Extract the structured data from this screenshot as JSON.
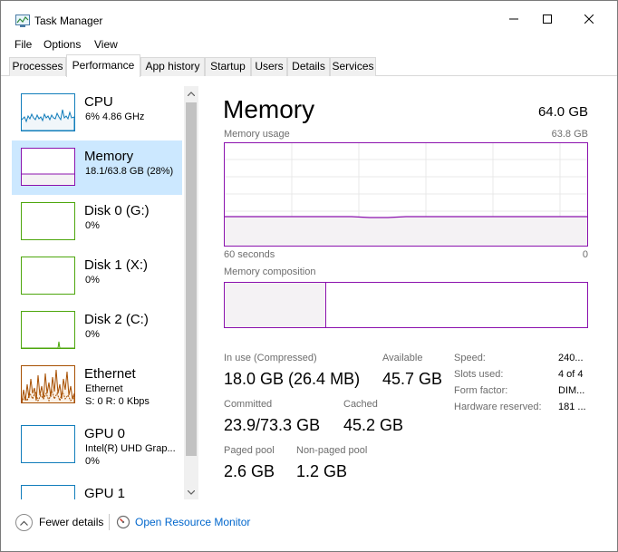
{
  "window": {
    "title": "Task Manager",
    "colors": {
      "accent_memory": "#8b12ae",
      "accent_cpu": "#117dbb",
      "accent_disk": "#4da60c",
      "accent_eth": "#a74f01",
      "selected_bg": "#cce8ff",
      "link": "#0066cc"
    }
  },
  "menu": [
    "File",
    "Options",
    "View"
  ],
  "tabs": [
    {
      "label": "Processes",
      "active": false
    },
    {
      "label": "Performance",
      "active": true
    },
    {
      "label": "App history",
      "active": false
    },
    {
      "label": "Startup",
      "active": false
    },
    {
      "label": "Users",
      "active": false
    },
    {
      "label": "Details",
      "active": false
    },
    {
      "label": "Services",
      "active": false
    }
  ],
  "sidebar": {
    "items": [
      {
        "name": "CPU",
        "sub": "6% 4.86 GHz",
        "sub2": "",
        "icon": "cpu-graph",
        "selected": false
      },
      {
        "name": "Memory",
        "sub": "18.1/63.8 GB (28%)",
        "sub2": "",
        "icon": "memory-graph",
        "selected": true
      },
      {
        "name": "Disk 0 (G:)",
        "sub": "0%",
        "sub2": "",
        "icon": "disk-graph",
        "selected": false
      },
      {
        "name": "Disk 1 (X:)",
        "sub": "0%",
        "sub2": "",
        "icon": "disk-graph",
        "selected": false
      },
      {
        "name": "Disk 2 (C:)",
        "sub": "0%",
        "sub2": "",
        "icon": "disk-graph",
        "selected": false
      },
      {
        "name": "Ethernet",
        "sub": "Ethernet",
        "sub2": "S: 0 R: 0 Kbps",
        "icon": "ethernet-graph",
        "selected": false
      },
      {
        "name": "GPU 0",
        "sub": "Intel(R) UHD Grap...",
        "sub2": "0%",
        "icon": "gpu-graph",
        "selected": false
      },
      {
        "name": "GPU 1",
        "sub": "",
        "sub2": "",
        "icon": "gpu-graph",
        "selected": false
      }
    ]
  },
  "main": {
    "title": "Memory",
    "total": "64.0 GB",
    "usage_label": "Memory usage",
    "usage_max": "63.8 GB",
    "time_left": "60 seconds",
    "time_right": "0",
    "composition_label": "Memory composition",
    "usage_fraction": 0.28,
    "stats": {
      "in_use_label": "In use (Compressed)",
      "in_use_value": "18.0 GB (26.4 MB)",
      "available_label": "Available",
      "available_value": "45.7 GB",
      "committed_label": "Committed",
      "committed_value": "23.9/73.3 GB",
      "cached_label": "Cached",
      "cached_value": "45.2 GB",
      "paged_label": "Paged pool",
      "paged_value": "2.6 GB",
      "nonpaged_label": "Non-paged pool",
      "nonpaged_value": "1.2 GB"
    },
    "specs": {
      "speed_label": "Speed:",
      "speed_value": "240...",
      "slots_label": "Slots used:",
      "slots_value": "4 of 4",
      "form_label": "Form factor:",
      "form_value": "DIM...",
      "hw_label": "Hardware reserved:",
      "hw_value": "181 ..."
    }
  },
  "footer": {
    "fewer_details": "Fewer details",
    "resource_monitor": "Open Resource Monitor"
  }
}
